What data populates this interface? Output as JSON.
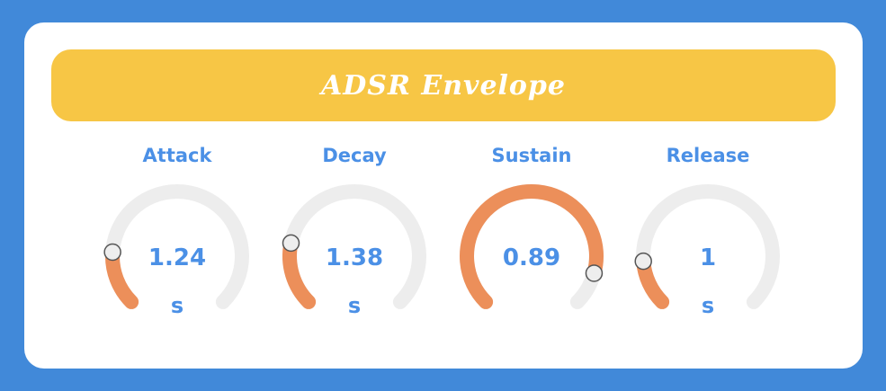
{
  "header": {
    "title": "ADSR Envelope"
  },
  "colors": {
    "background": "#4189d9",
    "banner": "#f7c645",
    "text": "#4b90e6",
    "track": "#ededed",
    "fill": "#ec8f5a",
    "handle": "#eeeeee"
  },
  "knobs": [
    {
      "label": "Attack",
      "value": "1.24",
      "unit": "s",
      "level": 0.18
    },
    {
      "label": "Decay",
      "value": "1.38",
      "unit": "s",
      "level": 0.21
    },
    {
      "label": "Sustain",
      "value": "0.89",
      "unit": "",
      "level": 0.89
    },
    {
      "label": "Release",
      "value": "1",
      "unit": "s",
      "level": 0.15
    }
  ]
}
